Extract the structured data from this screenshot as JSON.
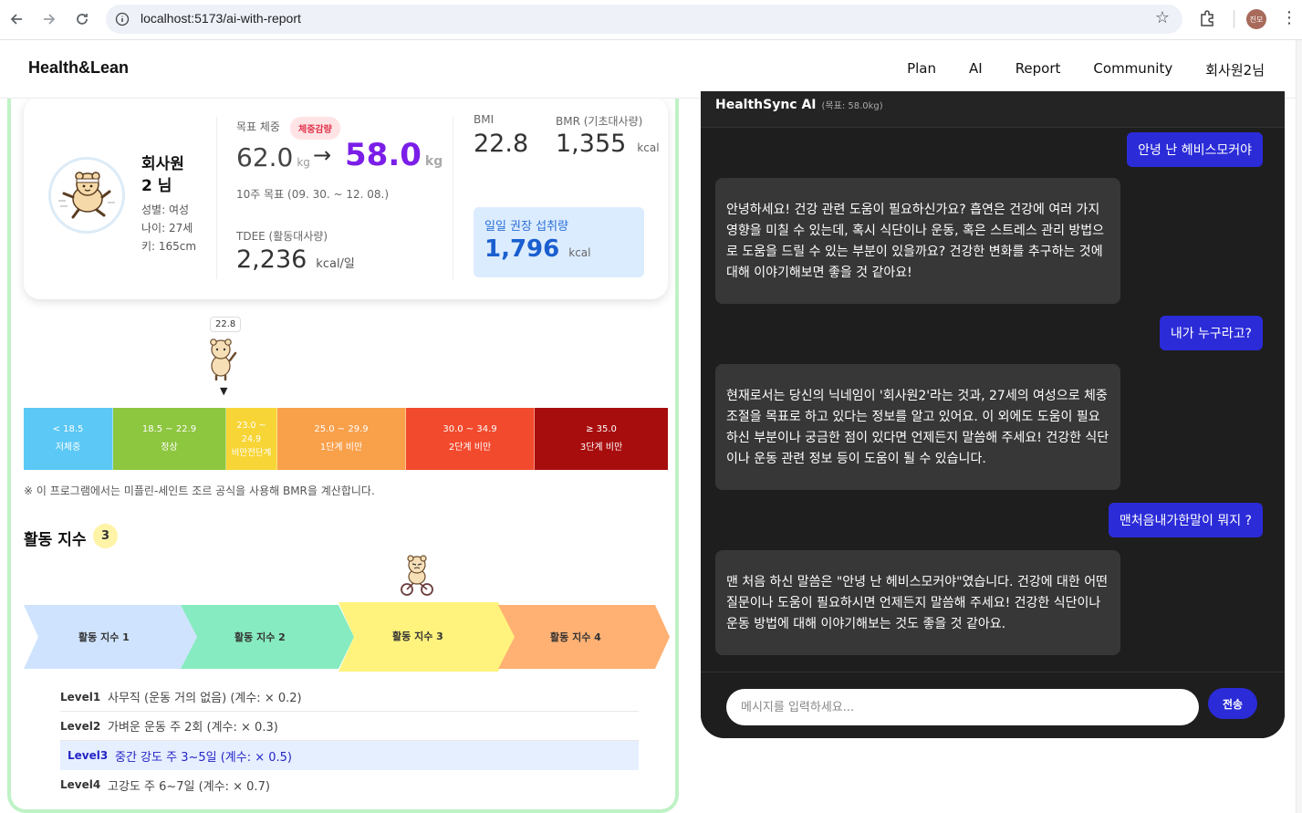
{
  "browser": {
    "url": "localhost:5173/ai-with-report",
    "profile_initials": "진모"
  },
  "header": {
    "logo": "Health&Lean",
    "nav": [
      "Plan",
      "AI",
      "Report",
      "Community",
      "회사원2님"
    ]
  },
  "profile": {
    "name_line1": "회사원",
    "name_line2": "2 님",
    "gender": "성별: 여성",
    "age": "나이: 27세",
    "height": "키: 165cm",
    "target_label": "목표 체중",
    "goal_badge": "체중감량",
    "current_weight": "62.0",
    "target_weight": "58.0",
    "weight_unit": "kg",
    "arrow": "→",
    "period": "10주 목표 (09. 30. ~ 12. 08.)",
    "tdee_label": "TDEE (활동대사량)",
    "tdee_value": "2,236",
    "tdee_unit": "kcal/일",
    "bmi_label": "BMI",
    "bmi_value": "22.8",
    "bmr_label": "BMR (기초대사량)",
    "bmr_value": "1,355",
    "bmr_unit": "kcal",
    "rec_label": "일일 권장 섭취량",
    "rec_value": "1,796",
    "rec_unit": "kcal"
  },
  "bmi_scale": {
    "pointer_value": "22.8",
    "pointer_marker": "▼",
    "segments": [
      {
        "range": "< 18.5",
        "label": "저체중",
        "color": "#5bc8f5"
      },
      {
        "range": "18.5 ~ 22.9",
        "label": "정상",
        "color": "#8dc63f"
      },
      {
        "range": "23.0 ~ 24.9",
        "label": "비만전단계",
        "color": "#f7d536"
      },
      {
        "range": "25.0 ~ 29.9",
        "label": "1단계 비만",
        "color": "#f9a04b"
      },
      {
        "range": "30.0 ~ 34.9",
        "label": "2단계 비만",
        "color": "#f24a2d"
      },
      {
        "range": "≥ 35.0",
        "label": "3단계 비만",
        "color": "#a80d0d"
      }
    ],
    "note": "※ 이 프로그램에서는 미플린-세인트 조르 공식을 사용해 BMR을 계산합니다."
  },
  "activity": {
    "title": "활동 지수",
    "current": "3",
    "steps": [
      {
        "label": "활동 지수 1",
        "color": "#cfe3ff"
      },
      {
        "label": "활동 지수 2",
        "color": "#86ebc0"
      },
      {
        "label": "활동 지수 3",
        "color": "#fff37d"
      },
      {
        "label": "활동 지수 4",
        "color": "#ffb173"
      }
    ],
    "levels": [
      {
        "level": "Level1",
        "desc": "사무직 (운동 거의 없음) (계수: × 0.2)"
      },
      {
        "level": "Level2",
        "desc": "가벼운 운동 주 2회 (계수: × 0.3)"
      },
      {
        "level": "Level3",
        "desc": "중간 강도 주 3~5일 (계수: × 0.5)"
      },
      {
        "level": "Level4",
        "desc": "고강도 주 6~7일 (계수: × 0.7)"
      }
    ]
  },
  "chat": {
    "title": "HealthSync AI",
    "subtitle": "(목표: 58.0kg)",
    "messages": [
      {
        "role": "user",
        "text": "안녕 난 헤비스모커야"
      },
      {
        "role": "ai",
        "text": "안녕하세요! 건강 관련 도움이 필요하신가요? 흡연은 건강에 여러 가지 영향을 미칠 수 있는데, 혹시 식단이나 운동, 혹은 스트레스 관리 방법으로 도움을 드릴 수 있는 부분이 있을까요? 건강한 변화를 추구하는 것에 대해 이야기해보면 좋을 것 같아요!"
      },
      {
        "role": "user",
        "text": "내가 누구라고?"
      },
      {
        "role": "ai",
        "text": "현재로서는 당신의 닉네임이 '회사원2'라는 것과, 27세의 여성으로 체중 조절을 목표로 하고 있다는 정보를 알고 있어요. 이 외에도 도움이 필요하신 부분이나 궁금한 점이 있다면 언제든지 말씀해 주세요! 건강한 식단이나 운동 관련 정보 등이 도움이 될 수 있습니다."
      },
      {
        "role": "user",
        "text": "맨처음내가한말이 뭐지 ?"
      },
      {
        "role": "ai",
        "text": "맨 처음 하신 말씀은 \"안녕 난 헤비스모커야\"였습니다. 건강에 대한 어떤 질문이나 도움이 필요하시면 언제든지 말씀해 주세요! 건강한 식단이나 운동 방법에 대해 이야기해보는 것도 좋을 것 같아요."
      }
    ],
    "input_placeholder": "메시지를 입력하세요...",
    "send_label": "전송"
  }
}
